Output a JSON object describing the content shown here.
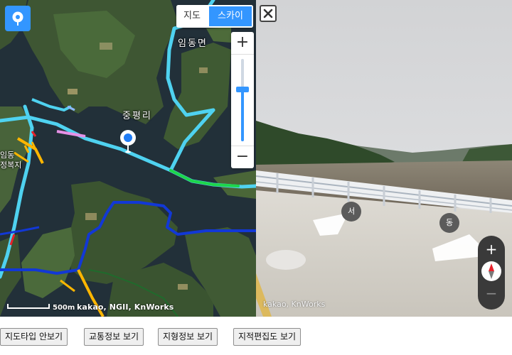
{
  "map": {
    "type_control": {
      "map_label": "지도",
      "skyview_label": "스카이뷰",
      "active": "스카이뷰"
    },
    "zoom": {
      "plus_label": "+",
      "minus_label": "−",
      "level_fraction": 0.63
    },
    "place_labels": {
      "imdong_myeon": "임동면",
      "jungpyeong_ri": "중평리",
      "left_label": "임동\n정복지"
    },
    "attribution": "kakao, NGII, KnWorks",
    "scale_label": "500m",
    "colors": {
      "accent": "#3396ff",
      "road_cyan": "#4fd2f0",
      "road_blue": "#1238d6",
      "road_green": "#1ed64a",
      "road_yellow": "#ffb600"
    }
  },
  "roadview": {
    "close_icon": "close-icon",
    "direction_labels": {
      "west": "서",
      "east": "동"
    },
    "zoom_plus_label": "+",
    "zoom_minus_label": "−",
    "attribution": "kakao, KnWorks"
  },
  "buttons": [
    {
      "label": "지도타입 안보기"
    },
    {
      "label": "교통정보 보기"
    },
    {
      "label": "지형정보 보기"
    },
    {
      "label": "지적편집도 보기"
    }
  ]
}
